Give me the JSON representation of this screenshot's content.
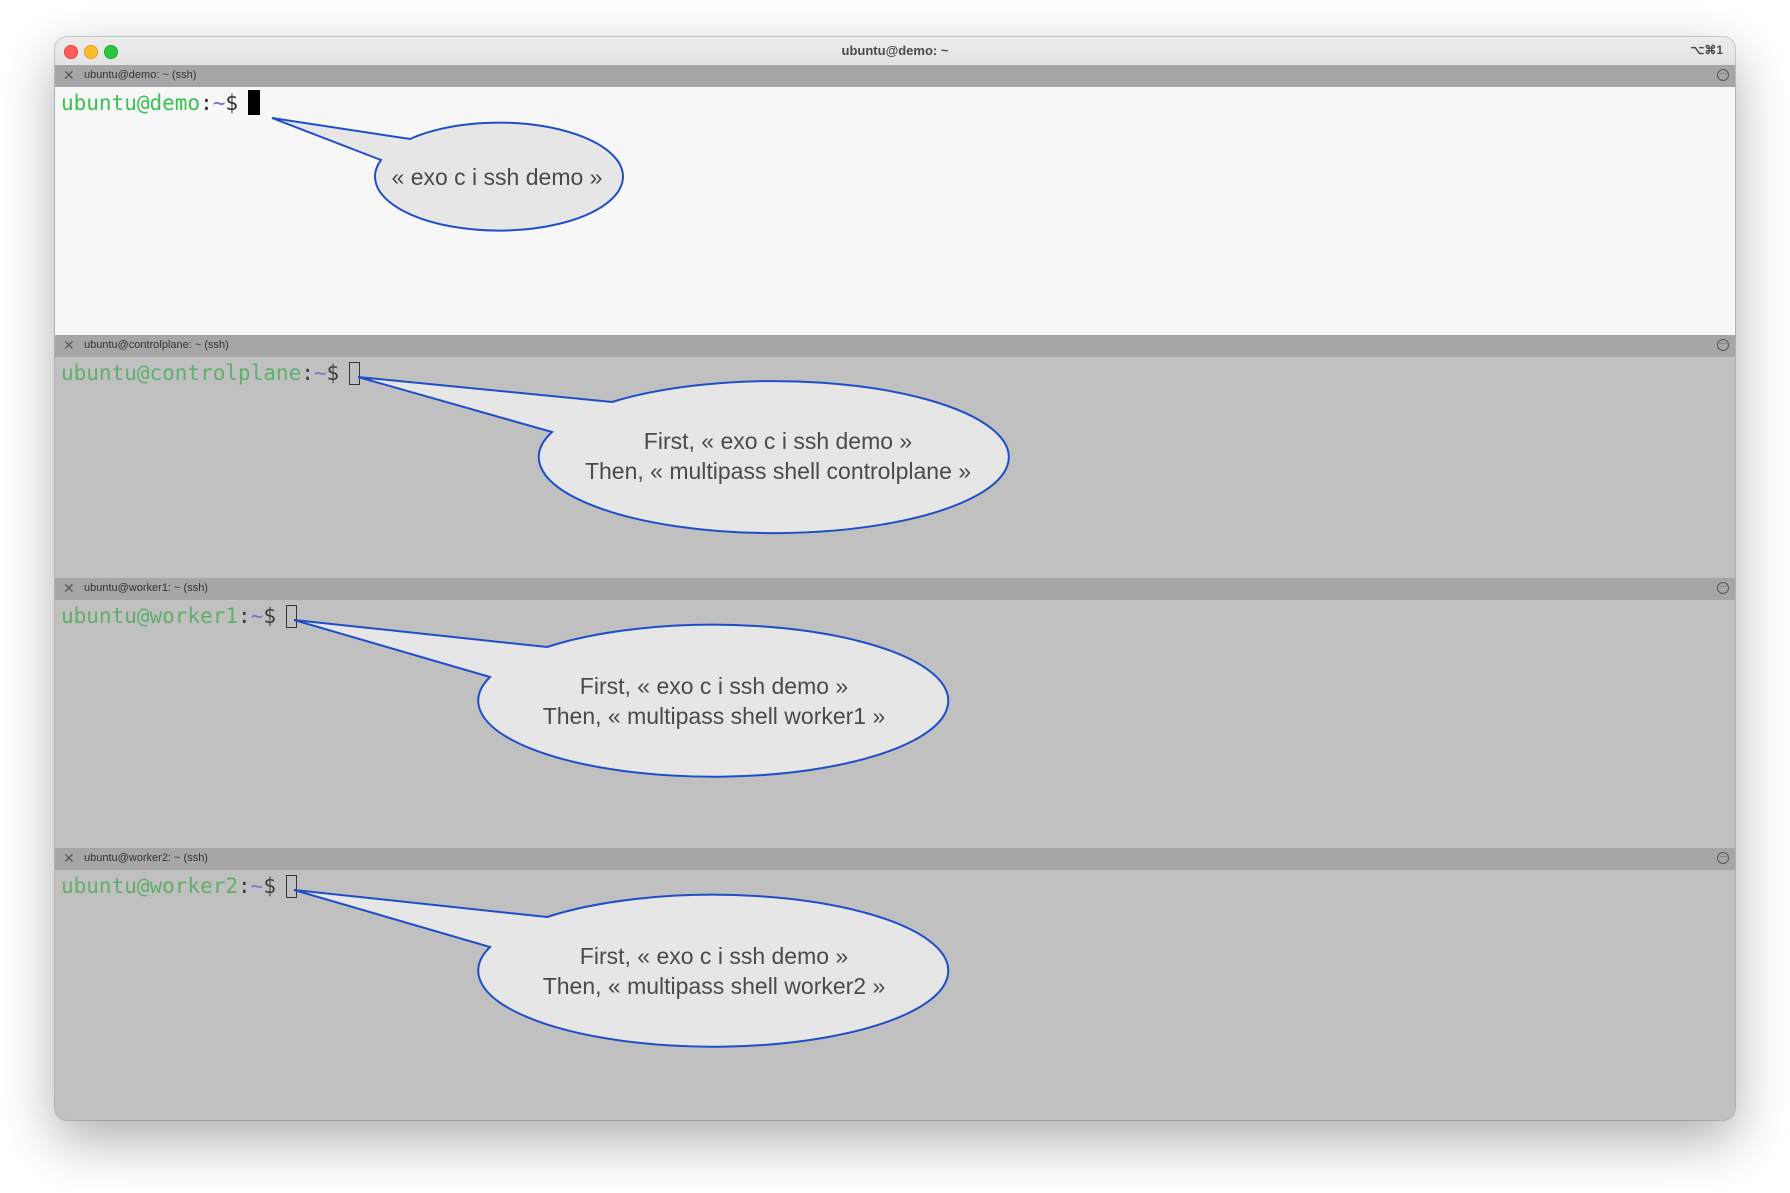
{
  "window": {
    "title": "ubuntu@demo: ~",
    "shortcut": "⌥⌘1"
  },
  "panes": [
    {
      "tab_title": "ubuntu@demo: ~ (ssh)",
      "active": true,
      "prompt": {
        "user_host": "ubuntu@demo",
        "colon": ":",
        "path": "~",
        "dollar": "$"
      },
      "callout": [
        "« exo c i ssh demo »"
      ]
    },
    {
      "tab_title": "ubuntu@controlplane: ~ (ssh)",
      "active": false,
      "prompt": {
        "user_host": "ubuntu@controlplane",
        "colon": ":",
        "path": "~",
        "dollar": "$"
      },
      "callout": [
        "First, « exo c i ssh demo »",
        "Then, « multipass shell controlplane »"
      ]
    },
    {
      "tab_title": "ubuntu@worker1: ~ (ssh)",
      "active": false,
      "prompt": {
        "user_host": "ubuntu@worker1",
        "colon": ":",
        "path": "~",
        "dollar": "$"
      },
      "callout": [
        "First, « exo c i ssh demo »",
        "Then, « multipass shell worker1 »"
      ]
    },
    {
      "tab_title": "ubuntu@worker2: ~ (ssh)",
      "active": false,
      "prompt": {
        "user_host": "ubuntu@worker2",
        "colon": ":",
        "path": "~",
        "dollar": "$"
      },
      "callout": [
        "First, « exo c i ssh demo »",
        "Then, « multipass shell worker2 »"
      ]
    }
  ],
  "icons": {
    "close": "close-icon",
    "more": "more-options-icon"
  },
  "colors": {
    "prompt_user": "#38c24f",
    "prompt_path": "#6a6ad8",
    "active_bg": "#f7f7f7",
    "inactive_bg": "#c0c0c0",
    "callout_fill": "#e6e6e6",
    "callout_stroke": "#1e4fc8"
  }
}
